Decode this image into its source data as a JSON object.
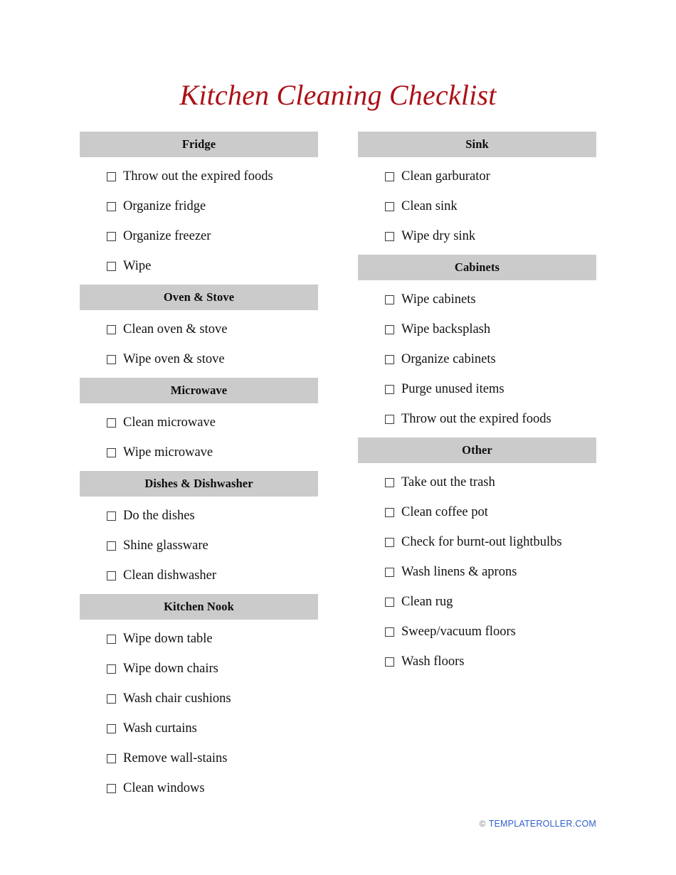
{
  "document": {
    "title": "Kitchen Cleaning Checklist",
    "title_color": "#ab1117",
    "header_bar_color": "#cbcbcb",
    "checkbox_state": "unchecked"
  },
  "columns": [
    {
      "name": "left-column",
      "sections": [
        {
          "heading": "Fridge",
          "items": [
            "Throw out the expired foods",
            "Organize fridge",
            "Organize freezer",
            "Wipe"
          ]
        },
        {
          "heading": "Oven & Stove",
          "items": [
            "Clean oven & stove",
            "Wipe oven & stove"
          ]
        },
        {
          "heading": "Microwave",
          "items": [
            "Clean microwave",
            "Wipe microwave"
          ]
        },
        {
          "heading": "Dishes & Dishwasher",
          "items": [
            "Do the dishes",
            "Shine glassware",
            "Clean dishwasher"
          ]
        },
        {
          "heading": "Kitchen Nook",
          "items": [
            "Wipe down table",
            "Wipe down chairs",
            "Wash chair cushions",
            "Wash curtains",
            "Remove wall-stains",
            "Clean windows"
          ]
        }
      ]
    },
    {
      "name": "right-column",
      "sections": [
        {
          "heading": "Sink",
          "items": [
            "Clean garburator",
            "Clean sink",
            "Wipe dry sink"
          ]
        },
        {
          "heading": "Cabinets",
          "items": [
            "Wipe cabinets",
            "Wipe backsplash",
            "Organize cabinets",
            "Purge unused items",
            "Throw out the expired foods"
          ]
        },
        {
          "heading": "Other",
          "items": [
            "Take out the trash",
            "Clean coffee pot",
            "Check for burnt-out lightbulbs",
            "Wash linens & aprons",
            "Clean rug",
            "Sweep/vacuum floors",
            "Wash floors"
          ]
        }
      ]
    }
  ],
  "footer": {
    "copyright_icon": "copyright-icon",
    "copyright_symbol": "©",
    "brand": "TEMPLATEROLLER.COM",
    "brand_color": "#2f5fd0"
  }
}
